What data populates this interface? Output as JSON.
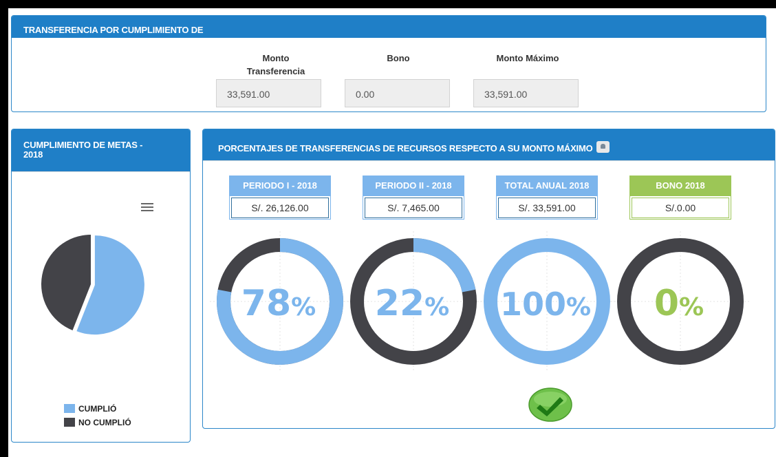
{
  "transfer_panel": {
    "title": "TRANSFERENCIA POR CUMPLIMIENTO DE",
    "columns": [
      {
        "label_line1": "Monto",
        "label_line2": "Transferencia",
        "value": "33,591.00"
      },
      {
        "label_line1": "Bono",
        "label_line2": "",
        "value": "0.00"
      },
      {
        "label_line1": "Monto Máximo",
        "label_line2": "",
        "value": "33,591.00"
      }
    ]
  },
  "metas_panel": {
    "title_line1": "CUMPLIMIENTO DE METAS -",
    "title_line2": "2018",
    "menu_icon": "hamburger-menu-icon",
    "chart_data": {
      "type": "pie",
      "series": [
        {
          "name": "CUMPLIÓ",
          "value": 56,
          "color": "#7cb5ec"
        },
        {
          "name": "NO CUMPLIÓ",
          "value": 44,
          "color": "#434348"
        }
      ]
    },
    "legend": [
      "CUMPLIÓ",
      "NO CUMPLIÓ"
    ]
  },
  "porcentajes_panel": {
    "title": "PORCENTAJES DE TRANSFERENCIAS DE RECURSOS RESPECTO A SU MONTO MÁXIMO",
    "title_icon": "bell-icon",
    "periods": [
      {
        "label": "PERIODO I - 2018",
        "amount": "S/. 26,126.00",
        "percent": 78,
        "percent_text": "78",
        "color": "#7cb5ec"
      },
      {
        "label": "PERIODO II - 2018",
        "amount": "S/. 7,465.00",
        "percent": 22,
        "percent_text": "22",
        "color": "#7cb5ec"
      },
      {
        "label": "TOTAL ANUAL 2018",
        "amount": "S/. 33,591.00",
        "percent": 100,
        "percent_text": "100",
        "color": "#7cb5ec"
      },
      {
        "label": "BONO 2018",
        "amount": "S/.0.00",
        "percent": 0,
        "percent_text": "0",
        "color": "#9cc656"
      }
    ],
    "percent_sign": "%",
    "status_icon": "check-icon"
  },
  "colors": {
    "header_blue": "#1f7fc7",
    "light_blue": "#7cb5ec",
    "dark_gray": "#434348",
    "green": "#9cc656"
  }
}
